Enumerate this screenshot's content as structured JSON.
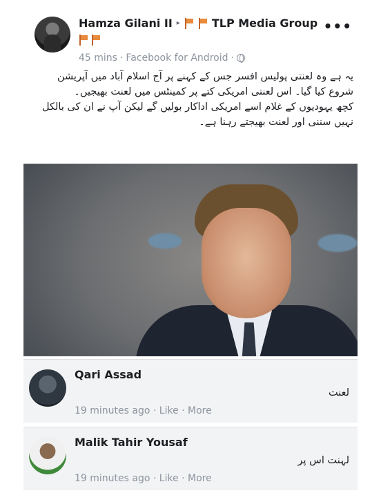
{
  "post": {
    "author": "Hamza Gilani II",
    "separator": "▸",
    "group": "TLP Media Group",
    "more": "•••",
    "time": "45 mins",
    "via": "Facebook for Android",
    "meta_dot": "·",
    "paragraph1": "یہ ہے وہ لعنتی پولیس افسر جس کے کہنے پر آج اسلام آباد میں آپریشن شروع کیا گیا۔ اس لعنتی امریکی کتے پر کمینٹس میں لعنت بھیجیں۔",
    "paragraph2": "کچھ یہودیوں کے غلام اسے امریکی اداکار بولیں گے لیکن آپ نے ان کی بالکل نہیں سننی اور لعنت بھیجتے رہنا ہے۔"
  },
  "comments": [
    {
      "name": "Qari Assad",
      "text": "لعنت",
      "meta": "19 minutes ago · Like · More"
    },
    {
      "name": "Malik Tahir Yousaf",
      "text": "لہنت اس پر",
      "meta": "19 minutes ago · Like · More"
    }
  ],
  "colors": {
    "flag_orange": "#e98a3c",
    "meta_gray": "#8d949e",
    "comment_bg": "#f2f3f5"
  }
}
